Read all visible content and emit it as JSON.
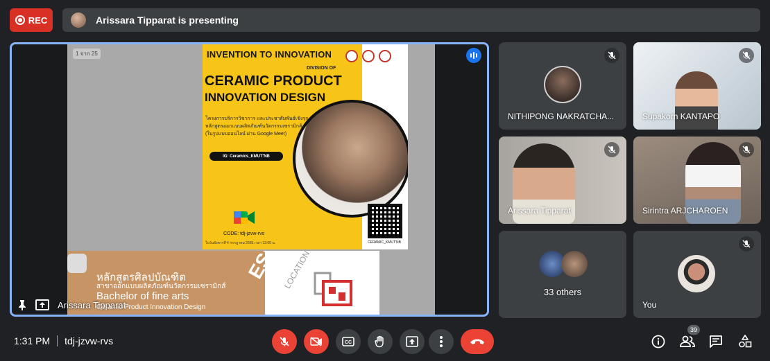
{
  "top": {
    "rec_label": "REC",
    "presenting_text": "Arissara Tipparat is presenting"
  },
  "stage": {
    "presenter_name": "Arissara Tipparat",
    "slide": {
      "page_tag": "1 จาก 25",
      "title_top": "INVENTION TO INNOVATION",
      "division": "DIVISION OF",
      "title_main_1": "CERAMIC PRODUCT",
      "title_main_2": "INNOVATION DESIGN",
      "thai_text": "โครงการบริการวิชาการ และประชาสัมพันธ์เชิงรุก หลักสูตรออกแบบผลิตภัณฑ์นวัตกรรมเซรามิกส์ (ในรูปแบบออนไลน์ ผ่าน Google Meet)",
      "ig": "IG: Ceramics_KMUT'NB",
      "code": "CODE: tdj-jzvw-rvs",
      "date": "ในวันอังคารที่ 4 กรกฎาคม 2565 เวลา 13:00 น.",
      "qr_label": "CERAMIC_KMUT'NB",
      "s2_line1": "หลักสูตรศิลปบัณฑิต",
      "s2_line2": "สาขาออกแบบผลิตภัณฑ์นวัตกรรมเซรามิกส์",
      "s2_line3": "Bachelor of fine arts",
      "s2_line4": "Ceramic Product Innovation Design",
      "s2_design": "ESIGN",
      "s2_location": "LOCATION"
    }
  },
  "participants": [
    {
      "name": "NITHIPONG NAKRATCHA..."
    },
    {
      "name": "Supakorn KANTAPO"
    },
    {
      "name": "Arissara Tipparat"
    },
    {
      "name": "Sirintra ARJCHAROEN"
    },
    {
      "name": "33 others"
    },
    {
      "name": "You"
    }
  ],
  "bottom": {
    "time": "1:31 PM",
    "meeting_code": "tdj-jzvw-rvs",
    "people_count": "39"
  },
  "colors": {
    "accent": "#8ab4f8",
    "danger": "#ea4335",
    "rec": "#d93025",
    "tile": "#3c4043",
    "background": "#202124"
  }
}
